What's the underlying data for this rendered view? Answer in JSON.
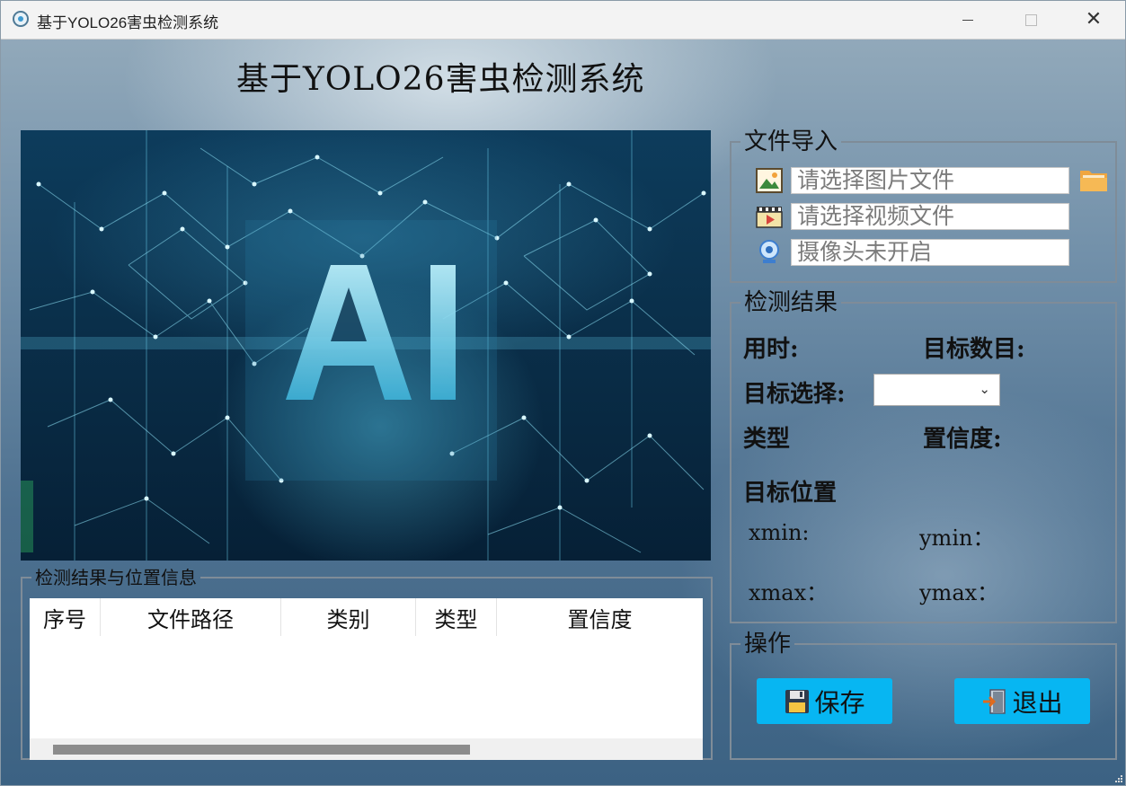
{
  "window": {
    "title": "基于YOLO26害虫检测系统"
  },
  "header": {
    "title": "基于YOLO26害虫检测系统"
  },
  "table_group": {
    "title": "检测结果与位置信息",
    "columns": [
      "序号",
      "文件路径",
      "类别",
      "类型",
      "置信度"
    ],
    "rows": []
  },
  "import": {
    "title": "文件导入",
    "image_placeholder": "请选择图片文件",
    "video_placeholder": "请选择视频文件",
    "camera_status": "摄像头未开启"
  },
  "result": {
    "title": "检测结果",
    "time_label": "用时:",
    "count_label": "目标数目:",
    "select_label": "目标选择:",
    "select_value": "",
    "type_label": "类型",
    "confidence_label": "置信度:",
    "position_label": "目标位置",
    "xmin_label": "xmin:",
    "ymin_label": "ymin：",
    "xmax_label": "xmax：",
    "ymax_label": "ymax："
  },
  "ops": {
    "title": "操作",
    "save_label": "保存",
    "exit_label": "退出"
  },
  "colors": {
    "button": "#07b6f2",
    "background_dark": "#3c6283",
    "background_light": "#97adbd"
  },
  "icons": {
    "image_file": "picture-icon",
    "video_file": "video-icon",
    "camera": "webcam-icon",
    "folder": "folder-icon",
    "save": "floppy-icon",
    "exit": "exit-door-icon"
  }
}
